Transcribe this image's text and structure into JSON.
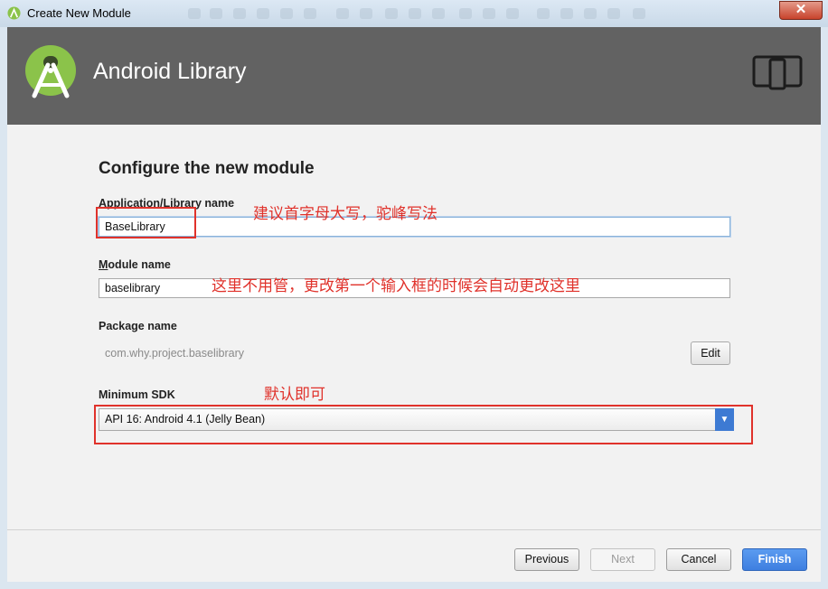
{
  "window": {
    "title": "Create New Module",
    "close_label": "✕"
  },
  "header": {
    "title": "Android Library",
    "logo_icon": "android-studio-logo",
    "device_icon": "tablet-phone-icon"
  },
  "form": {
    "heading": "Configure the new module",
    "app_name_label": "Application/Library name",
    "app_name_value": "BaseLibrary",
    "module_name_label_u": "M",
    "module_name_label_rest": "odule name",
    "module_name_value": "baselibrary",
    "package_name_label": "Package name",
    "package_name_value": "com.why.project.baselibrary",
    "edit_label": "Edit",
    "min_sdk_label": "Minimum SDK",
    "min_sdk_value": "API 16: Android 4.1 (Jelly Bean)"
  },
  "annotations": {
    "app_name_note": "建议首字母大写，驼峰写法",
    "module_name_note": "这里不用管，更改第一个输入框的时候会自动更改这里",
    "sdk_note": "默认即可",
    "color": "#e0322b"
  },
  "footer": {
    "previous": "Previous",
    "next": "Next",
    "cancel": "Cancel",
    "finish": "Finish"
  }
}
